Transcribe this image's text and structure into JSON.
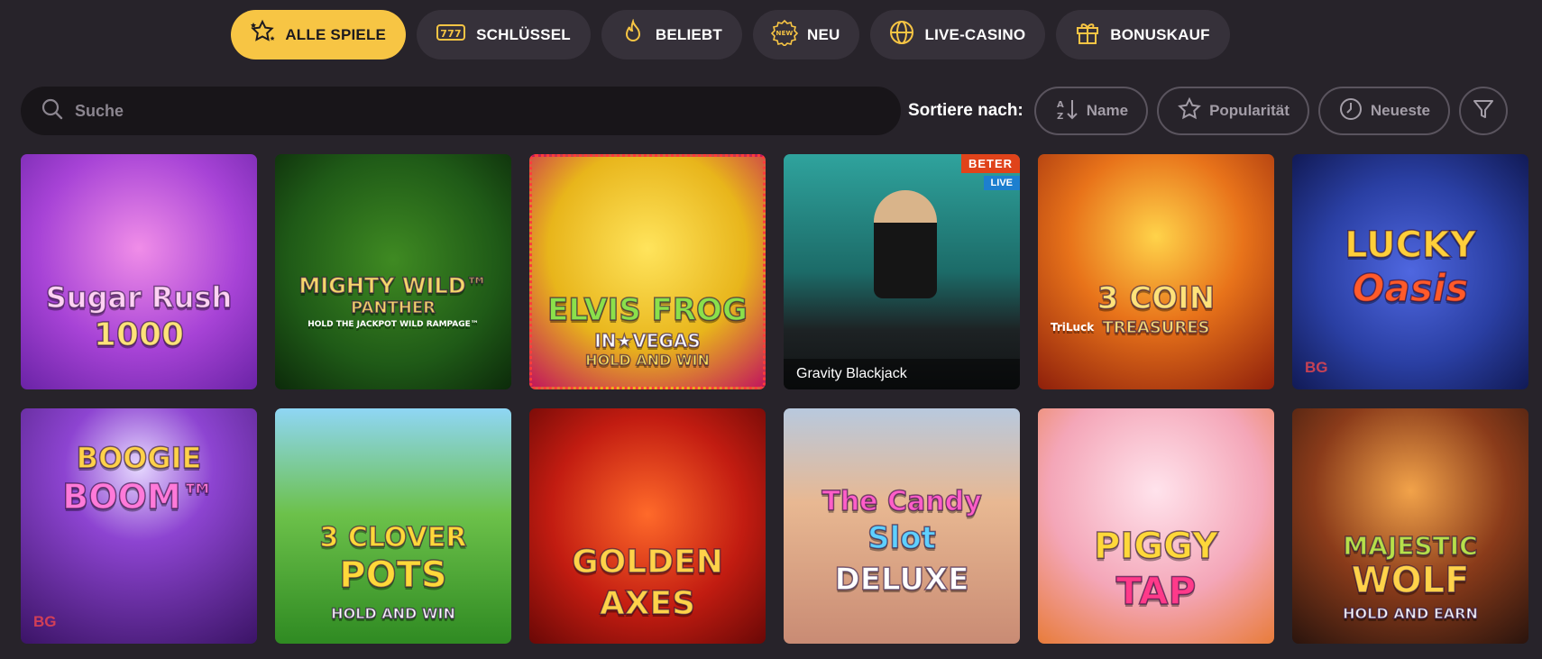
{
  "categories": [
    {
      "label": "ALLE SPIELE",
      "icon": "stars-icon",
      "active": true
    },
    {
      "label": "SCHLÜSSEL",
      "icon": "slot-machine-icon",
      "active": false
    },
    {
      "label": "BELIEBT",
      "icon": "flame-icon",
      "active": false
    },
    {
      "label": "NEU",
      "icon": "new-badge-icon",
      "active": false
    },
    {
      "label": "LIVE-CASINO",
      "icon": "globe-icon",
      "active": false
    },
    {
      "label": "BONUSKAUF",
      "icon": "gift-icon",
      "active": false
    }
  ],
  "search": {
    "placeholder": "Suche"
  },
  "sort": {
    "label": "Sortiere nach:",
    "options": [
      {
        "label": "Name",
        "icon": "sort-az-icon"
      },
      {
        "label": "Popularität",
        "icon": "star-icon"
      },
      {
        "label": "Neueste",
        "icon": "clock-icon"
      }
    ],
    "filter_icon": "filter-icon"
  },
  "games": [
    {
      "t1": "Sugar Rush",
      "t2": "1000",
      "t3": "",
      "bg": "#a743d6"
    },
    {
      "t1": "MIGHTY WILD™",
      "t2": "PANTHER",
      "t3": "HOLD THE JACKPOT WILD RAMPAGE™",
      "bg": "#1f5a17"
    },
    {
      "t1": "ELVIS FROG",
      "t2": "IN★VEGAS",
      "t3": "HOLD AND WIN",
      "bg": "#e8b51b"
    },
    {
      "t1": "",
      "t2": "",
      "t3": "",
      "bg": "#1c6b68",
      "badge": "BETER",
      "live": "LIVE",
      "caption": "Gravity Blackjack"
    },
    {
      "t1": "3 COIN",
      "t2": "TREASURES",
      "t3": "TriLuck",
      "bg": "#b8360e"
    },
    {
      "t1": "LUCKY",
      "t2": "Oasis",
      "t3": "",
      "bg": "#2a3fa3",
      "prov": "BG"
    },
    {
      "t1": "BOOGIE",
      "t2": "BOOM™",
      "t3": "",
      "bg": "#5b1f88",
      "prov": "BG"
    },
    {
      "t1": "3 CLOVER",
      "t2": "POTS",
      "t3": "HOLD AND WIN",
      "bg": "#3aa02d"
    },
    {
      "t1": "GOLDEN",
      "t2": "AXES",
      "t3": "",
      "bg": "#c21c11"
    },
    {
      "t1": "The Candy",
      "t2": "Slot",
      "t3": "DELUXE",
      "bg": "#c98b74"
    },
    {
      "t1": "PIGGY",
      "t2": "TAP",
      "t3": "",
      "bg": "#f4a6b8"
    },
    {
      "t1": "MAJESTIC",
      "t2": "WOLF",
      "t3": "HOLD AND EARN",
      "bg": "#4a2a1f"
    }
  ]
}
